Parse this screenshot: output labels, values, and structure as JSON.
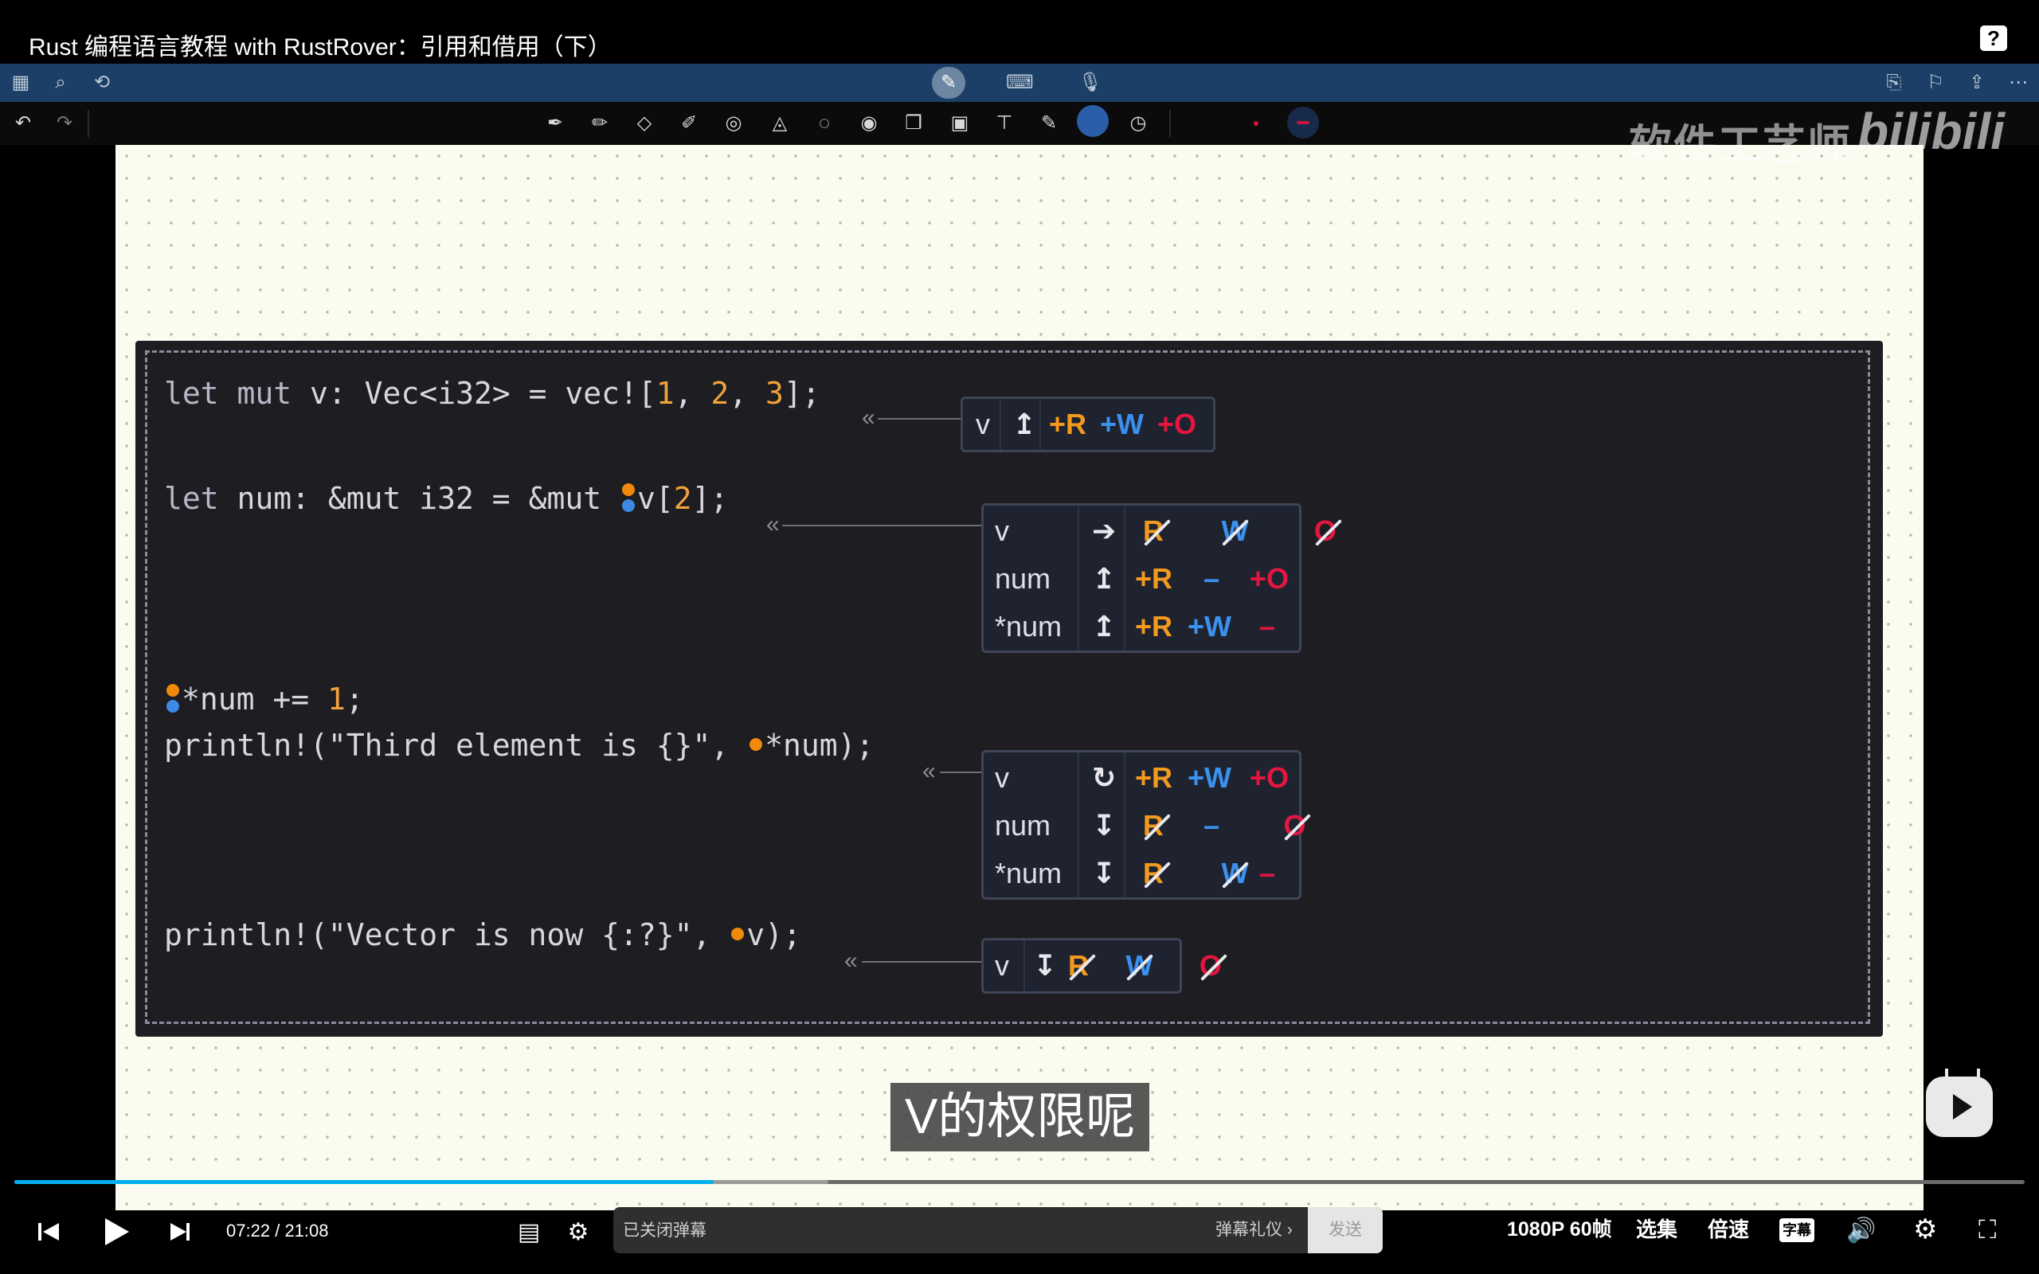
{
  "window": {
    "title": "Rust 编程语言教程 with RustRover：引用和借用（下）",
    "help_label": "?"
  },
  "watermark": {
    "text": "软件工艺师",
    "logo": "bilibili"
  },
  "app_bar": {
    "left_icons": [
      "grid-icon",
      "search-icon",
      "rotate-icon"
    ],
    "center_icons": [
      "pen-mode-icon",
      "keyboard-icon",
      "mic-icon"
    ],
    "right_icons": [
      "new-page-icon",
      "bookmark-icon",
      "share-icon",
      "more-icon"
    ]
  },
  "tool_bar": {
    "history": [
      "undo-icon",
      "redo-icon"
    ],
    "tools": [
      "pen-icon",
      "pencil-icon",
      "eraser-icon",
      "highlighter-icon",
      "zoom-icon",
      "shapes-icon",
      "lasso-icon",
      "laser-icon",
      "sticker-icon",
      "image-icon",
      "textbox-icon",
      "ruler-icon",
      "active-tool-icon",
      "timer-icon"
    ],
    "colors": {
      "red": "#d3143f",
      "navy": "#172a4a",
      "active": "#2a5ea8"
    }
  },
  "code": {
    "line1": {
      "kw1": "let",
      "kw2": "mut",
      "text": " v: Vec<i32> = vec![",
      "n1": "1",
      "n2": "2",
      "n3": "3",
      "end": "];"
    },
    "line2": {
      "kw1": "let",
      "text": " num: &mut i32 = &mut ",
      "rest": "v[",
      "n": "2",
      "end": "];"
    },
    "line3": {
      "text": "*num += ",
      "n": "1",
      "end": ";"
    },
    "line4": {
      "text": "println!(\"Third element is {}\", ",
      "rest": "*num);"
    },
    "line5": {
      "text": "println!(\"Vector is now {:?}\", ",
      "rest": "v);"
    }
  },
  "permissions": {
    "t1": {
      "rows": [
        {
          "name": "v",
          "sym": "↥",
          "r": "+R",
          "w": "+W",
          "o": "+O"
        }
      ]
    },
    "t2": {
      "rows": [
        {
          "name": "v",
          "sym": "➔",
          "r": "R",
          "w": "W",
          "o": "O"
        },
        {
          "name": "num",
          "sym": "↥",
          "r": "+R",
          "w": "–",
          "o": "+O"
        },
        {
          "name": "*num",
          "sym": "↥",
          "r": "+R",
          "w": "+W",
          "o": "–"
        }
      ]
    },
    "t3": {
      "rows": [
        {
          "name": "v",
          "sym": "↻",
          "r": "+R",
          "w": "+W",
          "o": "+O"
        },
        {
          "name": "num",
          "sym": "↧",
          "r": "R",
          "w": "–",
          "o": "O"
        },
        {
          "name": "*num",
          "sym": "↧",
          "r": "R",
          "w": "W",
          "o": "–"
        }
      ]
    },
    "t4": {
      "rows": [
        {
          "name": "v",
          "sym": "↧",
          "r": "R",
          "w": "W",
          "o": "O"
        }
      ]
    }
  },
  "subtitle": "V的权限呢",
  "player": {
    "current_time": "07:22",
    "separator": "/",
    "duration": "21:08",
    "progress_fraction": 0.348,
    "buffer_fraction": 0.405,
    "danmaku_placeholder": "已关闭弹幕",
    "etiquette": "弹幕礼仪 ›",
    "send": "发送",
    "quality": "1080P 60帧",
    "episodes": "选集",
    "speed": "倍速",
    "subtitle_btn": "字幕"
  },
  "colors": {
    "read": "#f29a1e",
    "write": "#3b91ee",
    "own": "#e3163f",
    "progress": "#00aeec"
  }
}
